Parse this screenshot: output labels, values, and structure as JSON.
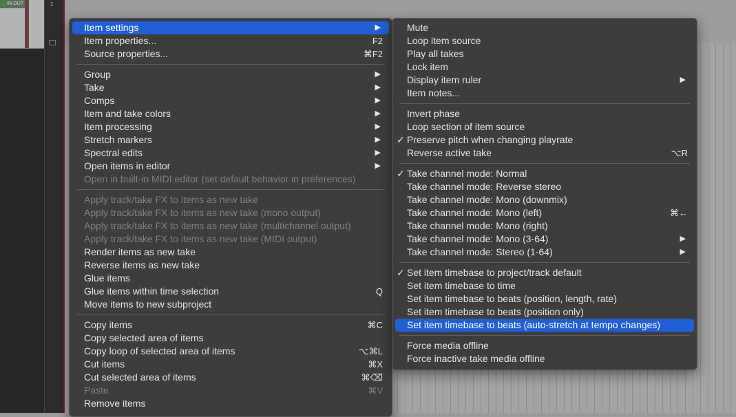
{
  "background": {
    "track_number": "1",
    "meter_label": "IN·OUT"
  },
  "main_menu": {
    "groups": [
      [
        {
          "label": "Item settings",
          "shortcut": "",
          "submenu": true,
          "disabled": false,
          "highlighted": true
        },
        {
          "label": "Item properties...",
          "shortcut": "F2",
          "submenu": false,
          "disabled": false
        },
        {
          "label": "Source properties...",
          "shortcut": "⌘F2",
          "submenu": false,
          "disabled": false
        }
      ],
      [
        {
          "label": "Group",
          "shortcut": "",
          "submenu": true,
          "disabled": false
        },
        {
          "label": "Take",
          "shortcut": "",
          "submenu": true,
          "disabled": false
        },
        {
          "label": "Comps",
          "shortcut": "",
          "submenu": true,
          "disabled": false
        },
        {
          "label": "Item and take colors",
          "shortcut": "",
          "submenu": true,
          "disabled": false
        },
        {
          "label": "Item processing",
          "shortcut": "",
          "submenu": true,
          "disabled": false
        },
        {
          "label": "Stretch markers",
          "shortcut": "",
          "submenu": true,
          "disabled": false
        },
        {
          "label": "Spectral edits",
          "shortcut": "",
          "submenu": true,
          "disabled": false
        },
        {
          "label": "Open items in editor",
          "shortcut": "",
          "submenu": true,
          "disabled": false
        },
        {
          "label": "Open in built-in MIDI editor (set default behavior in preferences)",
          "shortcut": "",
          "submenu": false,
          "disabled": true
        }
      ],
      [
        {
          "label": "Apply track/take FX to items as new take",
          "shortcut": "",
          "submenu": false,
          "disabled": true
        },
        {
          "label": "Apply track/take FX to items as new take (mono output)",
          "shortcut": "",
          "submenu": false,
          "disabled": true
        },
        {
          "label": "Apply track/take FX to items as new take (multichannel output)",
          "shortcut": "",
          "submenu": false,
          "disabled": true
        },
        {
          "label": "Apply track/take FX to items as new take (MIDI output)",
          "shortcut": "",
          "submenu": false,
          "disabled": true
        },
        {
          "label": "Render items as new take",
          "shortcut": "",
          "submenu": false,
          "disabled": false
        },
        {
          "label": "Reverse items as new take",
          "shortcut": "",
          "submenu": false,
          "disabled": false
        },
        {
          "label": "Glue items",
          "shortcut": "",
          "submenu": false,
          "disabled": false
        },
        {
          "label": "Glue items within time selection",
          "shortcut": "Q",
          "submenu": false,
          "disabled": false
        },
        {
          "label": "Move items to new subproject",
          "shortcut": "",
          "submenu": false,
          "disabled": false
        }
      ],
      [
        {
          "label": "Copy items",
          "shortcut": "⌘C",
          "submenu": false,
          "disabled": false
        },
        {
          "label": "Copy selected area of items",
          "shortcut": "",
          "submenu": false,
          "disabled": false
        },
        {
          "label": "Copy loop of selected area of items",
          "shortcut": "⌥⌘L",
          "submenu": false,
          "disabled": false
        },
        {
          "label": "Cut items",
          "shortcut": "⌘X",
          "submenu": false,
          "disabled": false
        },
        {
          "label": "Cut selected area of items",
          "shortcut": "⌘⌫",
          "submenu": false,
          "disabled": false
        },
        {
          "label": "Paste",
          "shortcut": "⌘V",
          "submenu": false,
          "disabled": true
        },
        {
          "label": "Remove items",
          "shortcut": "",
          "submenu": false,
          "disabled": false
        }
      ]
    ]
  },
  "sub_menu": {
    "groups": [
      [
        {
          "label": "Mute",
          "shortcut": "",
          "submenu": false,
          "checked": false
        },
        {
          "label": "Loop item source",
          "shortcut": "",
          "submenu": false,
          "checked": false
        },
        {
          "label": "Play all takes",
          "shortcut": "",
          "submenu": false,
          "checked": false
        },
        {
          "label": "Lock item",
          "shortcut": "",
          "submenu": false,
          "checked": false
        },
        {
          "label": "Display item ruler",
          "shortcut": "",
          "submenu": true,
          "checked": false
        },
        {
          "label": "Item notes...",
          "shortcut": "",
          "submenu": false,
          "checked": false
        }
      ],
      [
        {
          "label": "Invert phase",
          "shortcut": "",
          "submenu": false,
          "checked": false
        },
        {
          "label": "Loop section of item source",
          "shortcut": "",
          "submenu": false,
          "checked": false
        },
        {
          "label": "Preserve pitch when changing playrate",
          "shortcut": "",
          "submenu": false,
          "checked": true
        },
        {
          "label": "Reverse active take",
          "shortcut": "⌥R",
          "submenu": false,
          "checked": false
        }
      ],
      [
        {
          "label": "Take channel mode: Normal",
          "shortcut": "",
          "submenu": false,
          "checked": true
        },
        {
          "label": "Take channel mode: Reverse stereo",
          "shortcut": "",
          "submenu": false,
          "checked": false
        },
        {
          "label": "Take channel mode: Mono (downmix)",
          "shortcut": "",
          "submenu": false,
          "checked": false
        },
        {
          "label": "Take channel mode: Mono (left)",
          "shortcut": "⌘←",
          "submenu": false,
          "checked": false
        },
        {
          "label": "Take channel mode: Mono (right)",
          "shortcut": "",
          "submenu": false,
          "checked": false
        },
        {
          "label": "Take channel mode: Mono (3-64)",
          "shortcut": "",
          "submenu": true,
          "checked": false
        },
        {
          "label": "Take channel mode: Stereo (1-64)",
          "shortcut": "",
          "submenu": true,
          "checked": false
        }
      ],
      [
        {
          "label": "Set item timebase to project/track default",
          "shortcut": "",
          "submenu": false,
          "checked": true
        },
        {
          "label": "Set item timebase to time",
          "shortcut": "",
          "submenu": false,
          "checked": false
        },
        {
          "label": "Set item timebase to beats (position, length, rate)",
          "shortcut": "",
          "submenu": false,
          "checked": false
        },
        {
          "label": "Set item timebase to beats (position only)",
          "shortcut": "",
          "submenu": false,
          "checked": false
        },
        {
          "label": "Set item timebase to beats (auto-stretch at tempo changes)",
          "shortcut": "",
          "submenu": false,
          "checked": false,
          "highlighted": true
        }
      ],
      [
        {
          "label": "Force media offline",
          "shortcut": "",
          "submenu": false,
          "checked": false
        },
        {
          "label": "Force inactive take media offline",
          "shortcut": "",
          "submenu": false,
          "checked": false
        }
      ]
    ]
  },
  "colors": {
    "highlight": "#1f5fd7",
    "menu_bg": "#3d3d3d",
    "text": "#e6e6e6",
    "disabled_text": "#808080"
  }
}
